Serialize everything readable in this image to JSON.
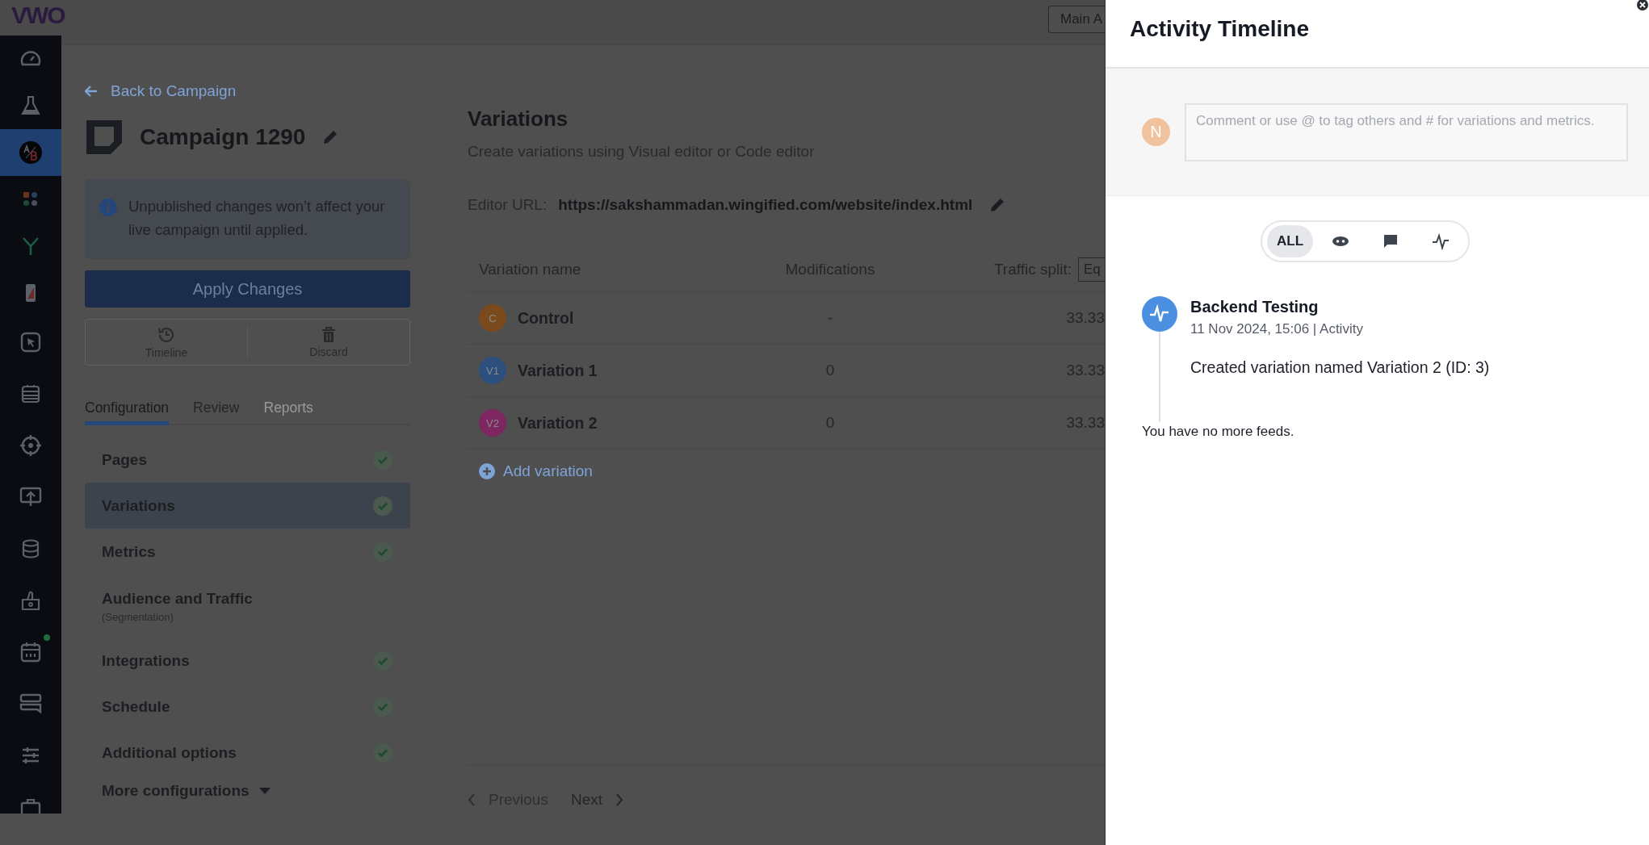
{
  "top_bar": {
    "logo": "VWO",
    "account_button": "Main A"
  },
  "nav": {
    "groups": [
      [
        {
          "kind": "gauge",
          "selected": false,
          "notification": false
        },
        {
          "kind": "flask",
          "selected": false,
          "notification": false
        },
        {
          "kind": "ab",
          "selected": true,
          "notification": false
        },
        {
          "kind": "apps",
          "selected": false,
          "notification": false
        },
        {
          "kind": "fork",
          "selected": false,
          "notification": false
        },
        {
          "kind": "phone",
          "selected": false,
          "notification": false
        }
      ],
      [
        {
          "kind": "cursor",
          "selected": false,
          "notification": false
        },
        {
          "kind": "list",
          "selected": false,
          "notification": false
        },
        {
          "kind": "target",
          "selected": false,
          "notification": false
        },
        {
          "kind": "upload",
          "selected": false,
          "notification": false
        },
        {
          "kind": "database",
          "selected": false,
          "notification": false
        },
        {
          "kind": "thumb",
          "selected": false,
          "notification": false
        },
        {
          "kind": "calendar",
          "selected": false,
          "notification": true
        },
        {
          "kind": "chat",
          "selected": false,
          "notification": false
        },
        {
          "kind": "sliders",
          "selected": false,
          "notification": false
        },
        {
          "kind": "briefcase",
          "selected": false,
          "notification": false
        }
      ]
    ]
  },
  "campaign_panel": {
    "back_link": "Back to Campaign",
    "title": "Campaign 1290",
    "info_message": "Unpublished changes won’t affect your live campaign until applied.",
    "apply_button": "Apply Changes",
    "actions": [
      {
        "kind": "timeline",
        "label": "Timeline"
      },
      {
        "kind": "discard",
        "label": "Discard"
      }
    ],
    "tabs": [
      {
        "label": "Configuration",
        "selected": true,
        "disabled": false
      },
      {
        "label": "Review",
        "selected": false,
        "disabled": false
      },
      {
        "label": "Reports",
        "selected": false,
        "disabled": true
      }
    ],
    "steps": [
      {
        "label": "Pages",
        "selected": false,
        "complete": true
      },
      {
        "label": "Variations",
        "selected": true,
        "complete": true
      },
      {
        "label": "Metrics",
        "selected": false,
        "complete": true
      },
      {
        "label": "Audience and Traffic",
        "sublabel": "(Segmentation)",
        "selected": false,
        "complete": false
      },
      {
        "label": "Integrations",
        "selected": false,
        "complete": true
      },
      {
        "label": "Schedule",
        "selected": false,
        "complete": true
      },
      {
        "label": "Additional options",
        "selected": false,
        "complete": true
      }
    ],
    "more_configurations": "More configurations"
  },
  "variations": {
    "heading": "Variations",
    "subtitle": "Create variations using Visual editor or Code editor",
    "editor_url_label": "Editor URL:",
    "editor_url": "https://sakshammadan.wingified.com/website/index.html",
    "columns": [
      "Variation name",
      "Modifications",
      "Traffic split:"
    ],
    "split_select": "Eq",
    "rows": [
      {
        "badge": "C",
        "color": "#7a4a1c",
        "name": "Control",
        "modifications": "-",
        "traffic": "33.33"
      },
      {
        "badge": "V1",
        "color": "#2d4f7e",
        "name": "Variation 1",
        "modifications": "0",
        "traffic": "33.33"
      },
      {
        "badge": "V2",
        "color": "#7e2660",
        "name": "Variation 2",
        "modifications": "0",
        "traffic": "33.33"
      }
    ],
    "add_variation": "Add variation",
    "pager": {
      "previous": "Previous",
      "next": "Next"
    }
  },
  "timeline_panel": {
    "title": "Activity Timeline",
    "comment": {
      "avatar": "N",
      "placeholder": "Comment or use @ to tag others and # for variations and metrics."
    },
    "filters": [
      {
        "kind": "all",
        "label": "ALL",
        "selected": true
      },
      {
        "kind": "eye",
        "selected": false
      },
      {
        "kind": "comment",
        "selected": false
      },
      {
        "kind": "activity",
        "selected": false
      }
    ],
    "entries": [
      {
        "title": "Backend Testing",
        "meta": "11 Nov 2024, 15:06 | Activity",
        "body": "Created variation named Variation 2 (ID: 3)"
      }
    ],
    "end_message": "You have no more feeds."
  }
}
